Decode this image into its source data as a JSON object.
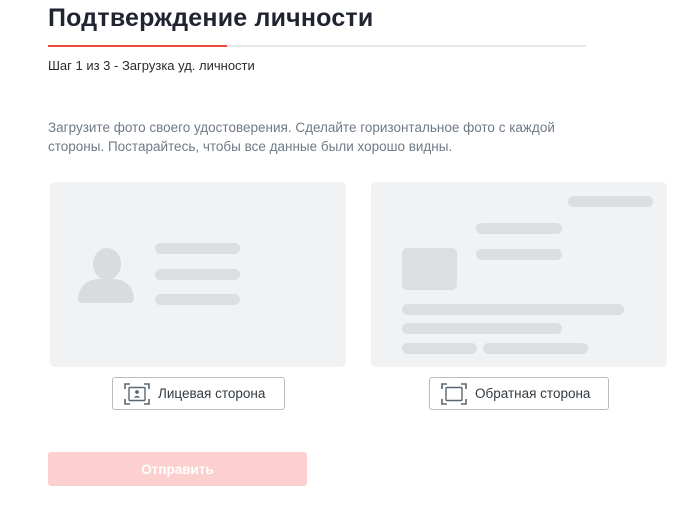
{
  "header": {
    "title": "Подтверждение личности",
    "step_label": "Шаг 1 из 3 - Загрузка уд. личности",
    "progress_fraction": 0.333
  },
  "instructions": "Загрузите фото своего удостоверения. Сделайте горизонтальное фото с каждой стороны. Постарайтесь, чтобы все данные были хорошо видны.",
  "front_side": {
    "button_label": "Лицевая сторона",
    "icon": "id-card-front-scan-icon"
  },
  "back_side": {
    "button_label": "Обратная сторона",
    "icon": "id-card-back-scan-icon"
  },
  "submit": {
    "label": "Отправить",
    "state": "disabled"
  },
  "colors": {
    "accent": "#e74c3c",
    "submit_disabled_bg": "#fbd0ce",
    "placeholder_bg": "#f1f2f3",
    "placeholder_shape": "#dcdfe1",
    "title_text": "#1f2430",
    "muted_text": "#6e7a86"
  }
}
